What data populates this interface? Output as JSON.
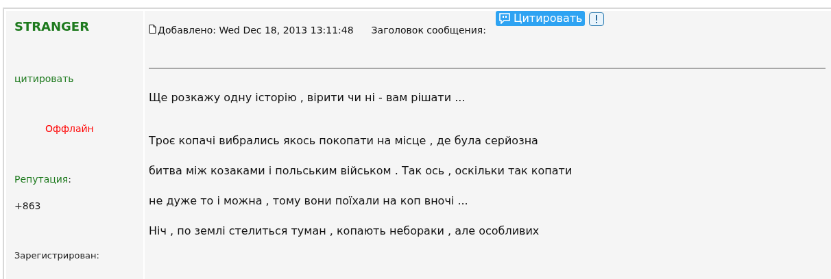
{
  "author": {
    "name": "STRANGER",
    "quote_link": "цитировать",
    "status": "Оффлайн",
    "reputation_label": "Репутация",
    "reputation_colon": ":",
    "reputation": "+863",
    "registered_label": "Зарегистрирован:"
  },
  "header": {
    "posted": "Добавлено: Wed Dec 18, 2013 13:11:48",
    "subject_label": "Заголовок сообщения:",
    "quote_button": "Цитировать"
  },
  "body": {
    "paragraphs": [
      [
        "Ще розкажу одну історію , вірити чи ні - вам рішати ..."
      ],
      [
        "Троє копачі вибрались якось покопати на місце , де була серйозна",
        "битва між козаками і польським військом . Так ось , оскільки так копати",
        "не дуже то і можна , тому вони поїхали на коп вночі ...",
        "Ніч , по землі стелиться туман , копають небораки , але особливих"
      ]
    ]
  }
}
